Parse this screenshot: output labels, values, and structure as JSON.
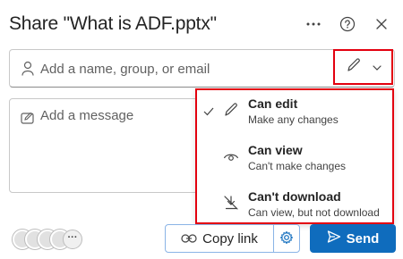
{
  "dialog": {
    "title": "Share \"What is ADF.pptx\"",
    "more_icon": "more-horizontal-icon",
    "help_icon": "help-icon",
    "close_icon": "close-icon"
  },
  "recipients": {
    "placeholder": "Add a name, group, or email",
    "icon": "person-icon"
  },
  "permission_button": {
    "icon": "pencil-icon",
    "chevron": "chevron-down-icon"
  },
  "message": {
    "placeholder": "Add a message",
    "icon": "edit-message-icon"
  },
  "permission_menu": {
    "items": [
      {
        "title": "Can edit",
        "subtitle": "Make any changes",
        "icon": "pencil-icon",
        "selected": true
      },
      {
        "title": "Can view",
        "subtitle": "Can't make changes",
        "icon": "eye-icon",
        "selected": false
      },
      {
        "title": "Can't download",
        "subtitle": "Can view, but not download",
        "icon": "no-download-icon",
        "selected": false
      }
    ]
  },
  "footer": {
    "more_people": "···",
    "copy_link_label": "Copy link",
    "send_label": "Send",
    "accent_color": "#0f6cbd",
    "highlight_color": "#e3000f"
  }
}
